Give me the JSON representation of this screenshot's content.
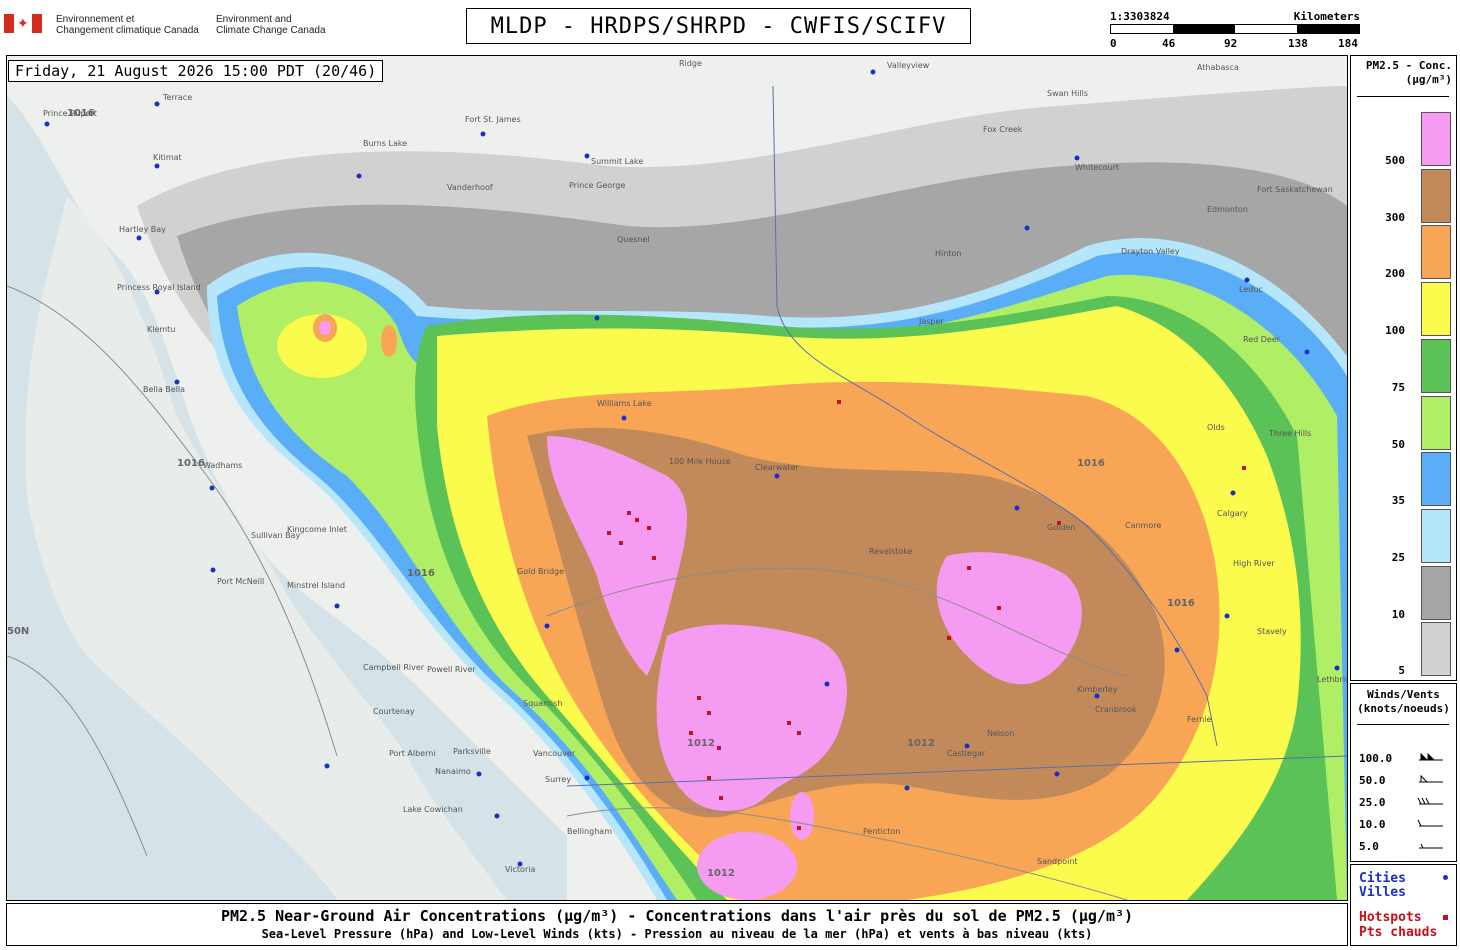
{
  "header": {
    "dept_fr_line1": "Environnement et",
    "dept_fr_line2": "Changement climatique Canada",
    "dept_en_line1": "Environment and",
    "dept_en_line2": "Climate Change Canada",
    "title": "MLDP - HRDPS/SHRPD - CWFIS/SCIFV"
  },
  "scale": {
    "ratio": "1:3303824",
    "units": "Kilometers",
    "ticks": [
      "0",
      "46",
      "92",
      "138",
      "184"
    ]
  },
  "map": {
    "timestamp": "Friday, 21 August 2026 15:00 PDT (20/46)",
    "places": [
      {
        "name": "Prince Rupert"
      },
      {
        "name": "Terrace"
      },
      {
        "name": "Kitimat"
      },
      {
        "name": "Hartley Bay"
      },
      {
        "name": "Princess Royal Island"
      },
      {
        "name": "Klemtu"
      },
      {
        "name": "Bella Bella"
      },
      {
        "name": "Wadhams"
      },
      {
        "name": "Sullivan Bay"
      },
      {
        "name": "Kingcome Inlet"
      },
      {
        "name": "Port McNeill"
      },
      {
        "name": "Minstrel Island"
      },
      {
        "name": "Campbell River"
      },
      {
        "name": "Powell River"
      },
      {
        "name": "Courtenay"
      },
      {
        "name": "Port Alberni"
      },
      {
        "name": "Parksville"
      },
      {
        "name": "Nanaimo"
      },
      {
        "name": "Lake Cowichan"
      },
      {
        "name": "Victoria"
      },
      {
        "name": "Vancouver"
      },
      {
        "name": "Surrey"
      },
      {
        "name": "Squamish"
      },
      {
        "name": "Bellingham"
      },
      {
        "name": "Gold Bridge"
      },
      {
        "name": "100 Mile House"
      },
      {
        "name": "Clearwater"
      },
      {
        "name": "Revelstoke"
      },
      {
        "name": "Prince George"
      },
      {
        "name": "Vanderhoof"
      },
      {
        "name": "Fort St. James"
      },
      {
        "name": "Burns Lake"
      },
      {
        "name": "Summit Lake"
      },
      {
        "name": "Valleyview"
      },
      {
        "name": "Ridge"
      },
      {
        "name": "Fox Creek"
      },
      {
        "name": "Whitecourt"
      },
      {
        "name": "Edmonton"
      },
      {
        "name": "Drayton Valley"
      },
      {
        "name": "Red Deer"
      },
      {
        "name": "Calgary"
      },
      {
        "name": "High River"
      },
      {
        "name": "Three Hills"
      },
      {
        "name": "Lethbridge"
      },
      {
        "name": "Cranbrook"
      },
      {
        "name": "Nelson"
      },
      {
        "name": "Castlegar"
      },
      {
        "name": "Kimberley"
      },
      {
        "name": "Golden"
      },
      {
        "name": "Canmore"
      },
      {
        "name": "Fernie"
      },
      {
        "name": "Penticton"
      },
      {
        "name": "Sandpoint"
      },
      {
        "name": "Williams Lake"
      },
      {
        "name": "Quesnel"
      },
      {
        "name": "Hinton"
      },
      {
        "name": "Jasper"
      },
      {
        "name": "Olds"
      },
      {
        "name": "Stavely"
      },
      {
        "name": "Swan Hills"
      },
      {
        "name": "Athabasca"
      },
      {
        "name": "Fort Saskatchewan"
      },
      {
        "name": "Leduc"
      }
    ],
    "isobar_labels": [
      "1016",
      "1012"
    ],
    "grid_label": "50N"
  },
  "legend": {
    "title_line1": "PM2.5 - Conc.",
    "title_line2": "(µg/m³)",
    "levels": [
      {
        "label": "500",
        "color": "#f59bf2"
      },
      {
        "label": "300",
        "color": "#c28a5a"
      },
      {
        "label": "200",
        "color": "#f8a656"
      },
      {
        "label": "100",
        "color": "#fbfb4e"
      },
      {
        "label": "75",
        "color": "#5ac257"
      },
      {
        "label": "50",
        "color": "#b0ee66"
      },
      {
        "label": "35",
        "color": "#5aaef8"
      },
      {
        "label": "25",
        "color": "#b6e6fb"
      },
      {
        "label": "10",
        "color": "#a6a6a6"
      },
      {
        "label": "5",
        "color": "#d1d1d1"
      }
    ]
  },
  "winds": {
    "title_line1": "Winds/Vents",
    "title_line2": "(knots/noeuds)",
    "rows": [
      "100.0",
      "50.0",
      "25.0",
      "10.0",
      "5.0"
    ]
  },
  "key": {
    "cities_line1": "Cities",
    "cities_line2": "Villes",
    "hotspots_line1": "Hotspots",
    "hotspots_line2": "Pts chauds",
    "city_color": "#1a2fc8",
    "hotspot_color": "#c8101a"
  },
  "footer": {
    "title": "PM2.5 Near-Ground Air Concentrations (µg/m³) - Concentrations dans l'air près du sol de PM2.5 (µg/m³)",
    "subtitle": "Sea-Level Pressure (hPa) and Low-Level Winds (kts) - Pression au niveau de la mer (hPa) et vents à bas niveau (kts)"
  }
}
